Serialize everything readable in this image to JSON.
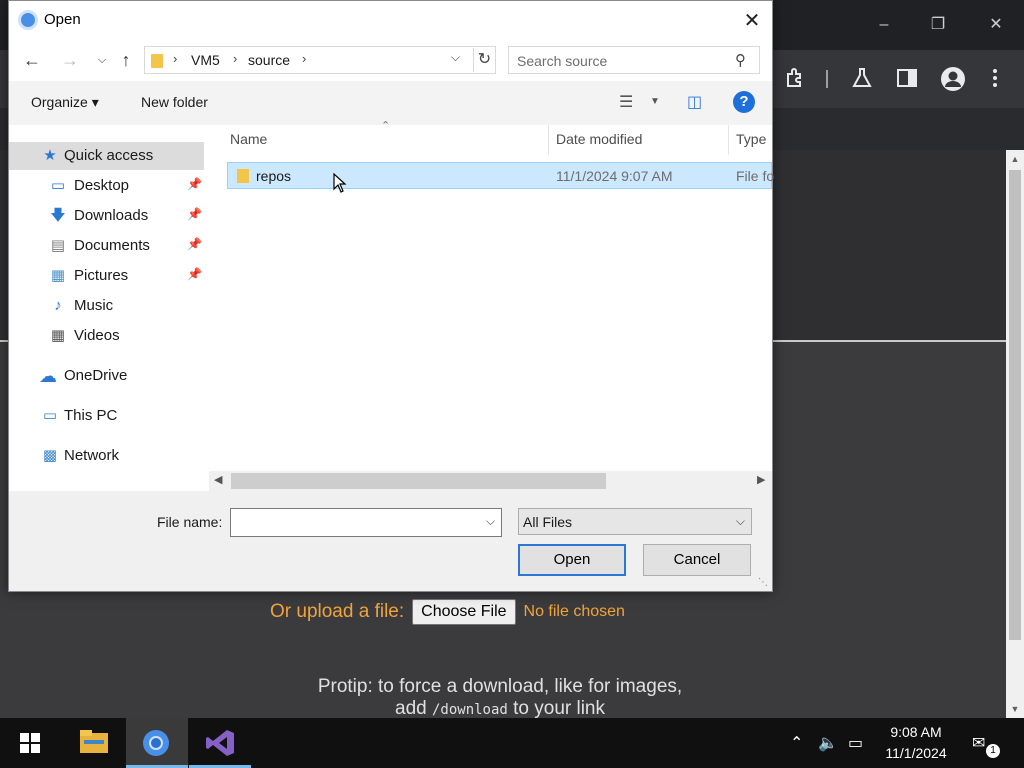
{
  "dialog": {
    "title": "Open",
    "breadcrumb": [
      "VM5",
      "source"
    ],
    "search_placeholder": "Search source",
    "organize_label": "Organize ▾",
    "new_folder_label": "New folder",
    "sidebar": {
      "quick_access": "Quick access",
      "items": [
        {
          "label": "Desktop",
          "icon": "desktop-icon",
          "pinned": true
        },
        {
          "label": "Downloads",
          "icon": "downloads-icon",
          "pinned": true
        },
        {
          "label": "Documents",
          "icon": "documents-icon",
          "pinned": true
        },
        {
          "label": "Pictures",
          "icon": "pictures-icon",
          "pinned": true
        },
        {
          "label": "Music",
          "icon": "music-icon",
          "pinned": false
        },
        {
          "label": "Videos",
          "icon": "videos-icon",
          "pinned": false
        }
      ],
      "onedrive": "OneDrive",
      "this_pc": "This PC",
      "network": "Network"
    },
    "columns": [
      "Name",
      "Date modified",
      "Type"
    ],
    "files": [
      {
        "name": "repos",
        "date": "11/1/2024 9:07 AM",
        "type": "File fo"
      }
    ],
    "file_name_label": "File name:",
    "file_name_value": "",
    "file_type": "All Files",
    "open_label": "Open",
    "cancel_label": "Cancel"
  },
  "page": {
    "upload_label": "Or upload a file:",
    "choose_file_label": "Choose File",
    "no_file_label": "No file chosen",
    "protip_line1": "Protip: to force a download, like for images,",
    "protip_add": "add",
    "protip_code": "/download",
    "protip_tail": "to your link"
  },
  "taskbar": {
    "time": "9:08 AM",
    "date": "11/1/2024",
    "notification_count": "1"
  },
  "colors": {
    "accent": "#2b78d4",
    "selection": "#cce8ff",
    "page_text_orange": "#f0a43c"
  }
}
